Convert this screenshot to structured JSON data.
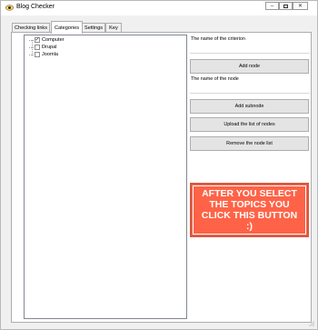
{
  "window": {
    "title": "Blog Checker",
    "icon": "eye-icon",
    "controls": {
      "minimize": "minimize-icon",
      "maximize": "maximize-icon",
      "close": "close-icon"
    }
  },
  "tabs": [
    {
      "label": "Checking links",
      "active": false
    },
    {
      "label": "Categories",
      "active": true
    },
    {
      "label": "Settings",
      "active": false
    },
    {
      "label": "Key",
      "active": false
    }
  ],
  "tree": {
    "items": [
      {
        "label": "Computer",
        "checked": true
      },
      {
        "label": "Drupal",
        "checked": false
      },
      {
        "label": "Joomla",
        "checked": false
      }
    ]
  },
  "form": {
    "criterion_label": "The name of the criterion",
    "criterion_value": "",
    "add_node_label": "Add node",
    "node_label": "The name of the node",
    "node_value": "",
    "add_subnode_label": "Add subnode",
    "upload_label": "Upload the list of nodes",
    "remove_label": "Remove the node list"
  },
  "big_button": {
    "label": "AFTER YOU SELECT THE TOPICS YOU CLICK THIS BUTTON :)",
    "color": "#ff6347"
  }
}
